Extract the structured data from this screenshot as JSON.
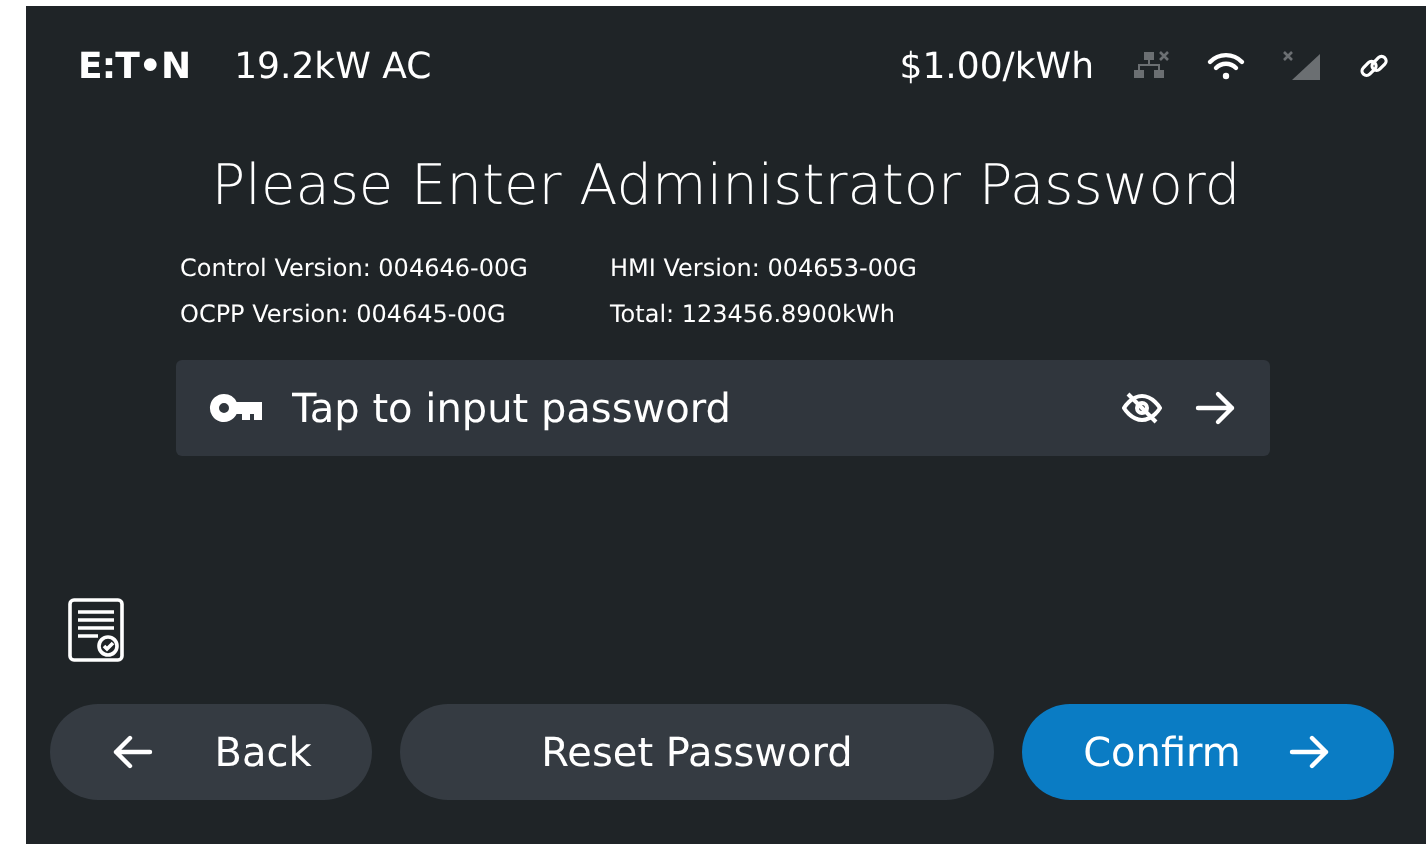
{
  "header": {
    "logo": "E:T•N",
    "power": "19.2kW AC",
    "price": "$1.00/kWh",
    "status_icons": [
      {
        "kind": "network",
        "connected": false
      },
      {
        "kind": "wifi",
        "connected": true
      },
      {
        "kind": "cellular",
        "connected": false
      },
      {
        "kind": "link",
        "connected": true
      }
    ]
  },
  "title": "Please Enter Administrator Password",
  "versions": [
    "Control Version: 004646-00G",
    "HMI Version: 004653-00G",
    "OCPP Version: 004645-00G",
    "Total: 123456.8900kWh"
  ],
  "password_field": {
    "placeholder": "Tap to input password"
  },
  "buttons": [
    {
      "kind": "back",
      "label": "Back"
    },
    {
      "kind": "secondary",
      "label": "Reset Password"
    },
    {
      "kind": "primary",
      "label": "Confirm"
    }
  ]
}
